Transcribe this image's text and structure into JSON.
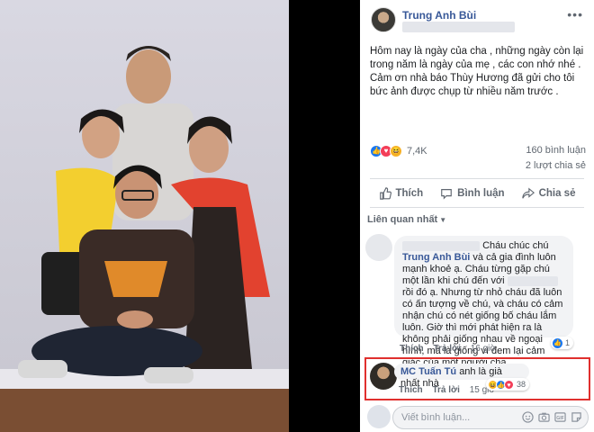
{
  "post": {
    "author": "Trung Anh Bùi",
    "more_label": "•••",
    "caption": "Hôm nay là ngày của cha , những ngày còn lại trong năm là ngày của mẹ , các con nhớ nhé . Cảm ơn nhà báo Thùy Hương đã gửi cho tôi bức ảnh được chụp từ nhiều năm trước ."
  },
  "stats": {
    "reaction_icons": [
      "like-icon",
      "love-icon",
      "haha-icon"
    ],
    "reactions": "7,4K",
    "comments": "160 bình luận",
    "shares": "2 lượt chia sẻ"
  },
  "actions": {
    "like": "Thích",
    "comment": "Bình luận",
    "share": "Chia sẻ"
  },
  "sort": {
    "label": "Liên quan nhất"
  },
  "comments": [
    {
      "author": "",
      "text_parts": [
        "Cháu chúc chú",
        "Trung Anh Bùi",
        "và cả gia đình luôn mạnh khoẻ ạ. Cháu từng gặp chú một lần khi chú đến với",
        "rồi đó ạ. Nhưng từ nhỏ cháu đã luôn có ấn tượng về chú, và cháu có cảm nhận chú có nét giống bố cháu lắm luôn. Giờ thì mới phát hiện ra là không phải giống nhau về ngoại hình, mà là giống vì đem lại cảm giác của một người cha..."
      ],
      "like": "Thích",
      "reply": "Trả lời",
      "time": "16 giờ",
      "reaction_count": "1"
    },
    {
      "author": "MC Tuấn Tú",
      "text": "anh là già nhất nhà",
      "like": "Thích",
      "reply": "Trả lời",
      "time": "15 giờ",
      "reaction_count": "38"
    }
  ],
  "composer": {
    "placeholder": "Viết bình luận..."
  },
  "colors": {
    "link": "#385898",
    "like_blue": "#1877f2",
    "highlight_red": "#e0302e",
    "bubble_bg": "#f2f3f5"
  }
}
